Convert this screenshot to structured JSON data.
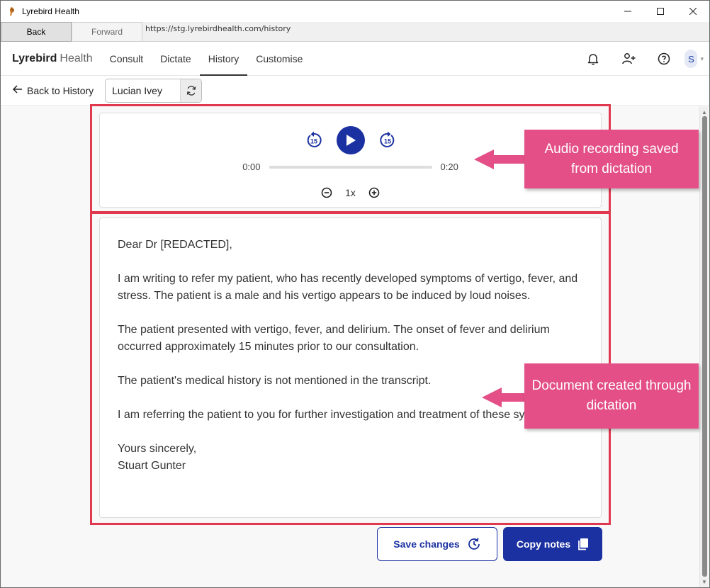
{
  "window": {
    "title": "Lyrebird Health"
  },
  "browser": {
    "back_label": "Back",
    "forward_label": "Forward",
    "url": "https://stg.lyrebirdhealth.com/history"
  },
  "header": {
    "brand_bold": "Lyrebird",
    "brand_light": "Health",
    "tabs": [
      {
        "label": "Consult"
      },
      {
        "label": "Dictate"
      },
      {
        "label": "History",
        "active": true
      },
      {
        "label": "Customise"
      }
    ],
    "avatar_initial": "S"
  },
  "subbar": {
    "back_label": "Back to History",
    "patient_name": "Lucian Ivey"
  },
  "player": {
    "current_time": "0:00",
    "duration": "0:20",
    "progress": 0,
    "speed": "1x",
    "skip_back": "15",
    "skip_forward": "15"
  },
  "letter": {
    "greeting": "Dear Dr [REDACTED],",
    "paragraphs": [
      "I am writing to refer my patient, who has recently developed symptoms of vertigo, fever, and stress. The patient is a male and his vertigo appears to be induced by loud noises.",
      "The patient presented with vertigo, fever, and delirium. The onset of fever and delirium occurred approximately 15 minutes prior to our consultation.",
      "The patient's medical history is not mentioned in the transcript.",
      "I am referring the patient to you for further investigation and treatment of these symptoms."
    ],
    "closing": "Yours sincerely,",
    "signature": "Stuart Gunter"
  },
  "callouts": {
    "audio": "Audio recording saved from dictation",
    "document": "Document created through dictation"
  },
  "actions": {
    "save_label": "Save changes",
    "copy_label": "Copy notes"
  },
  "colors": {
    "primary": "#1c31a1",
    "highlight": "#e0394f",
    "callout": "#e34f86"
  }
}
